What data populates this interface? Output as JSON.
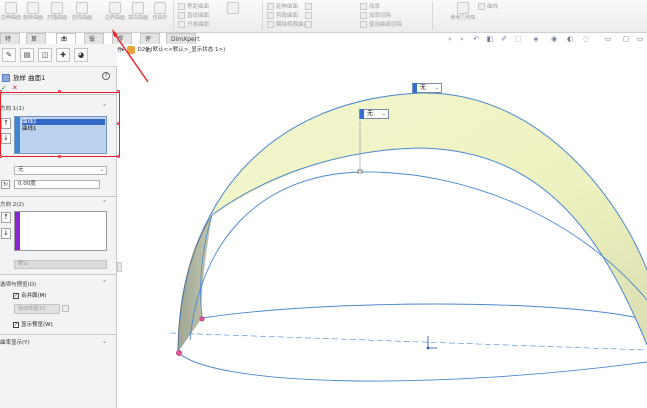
{
  "ribbon": {
    "big_buttons": [
      "拉伸曲面",
      "旋转曲面",
      "扫描曲面",
      "放样曲面",
      "边界曲面",
      "填充曲面",
      "自由形"
    ],
    "small_left": [
      "等距曲面",
      "直纹曲面",
      "只收曲面"
    ],
    "small_right1": [
      "延伸曲面",
      "剪裁曲面",
      "解除剪裁曲面"
    ],
    "small_right2": [
      "加厚",
      "加厚切除",
      "使用曲面切除"
    ],
    "far_right": [
      "参考几何体",
      "曲线"
    ]
  },
  "tabs": [
    "特征",
    "草图",
    "曲面",
    "钣金",
    "焊件",
    "评估",
    "DimXpert"
  ],
  "active_tab": "曲面",
  "panel": {
    "title": "放样 曲面1",
    "section1_title": "方向 1(1)",
    "list1": [
      "曲线2",
      "曲线1"
    ],
    "combo1": "无",
    "num1": "0.00度",
    "section2_title": "方向 2(2)",
    "btn_default": "默认",
    "section3_title": "选项与预览(O)",
    "cb_merge": "合并面(M)",
    "btn_preview": "拖动草图(D)",
    "cb_show": "显示预览(W)",
    "section4_title": "曲率显示(Y)"
  },
  "viewport": {
    "path": "D29 (默认<<默认>_显示状态 1>)",
    "label_top": "无",
    "label_mid": "无"
  },
  "colors": {
    "surface_fill": "#f1f5c6",
    "edge_blue": "#4a88cf",
    "red": "#e8202a"
  }
}
